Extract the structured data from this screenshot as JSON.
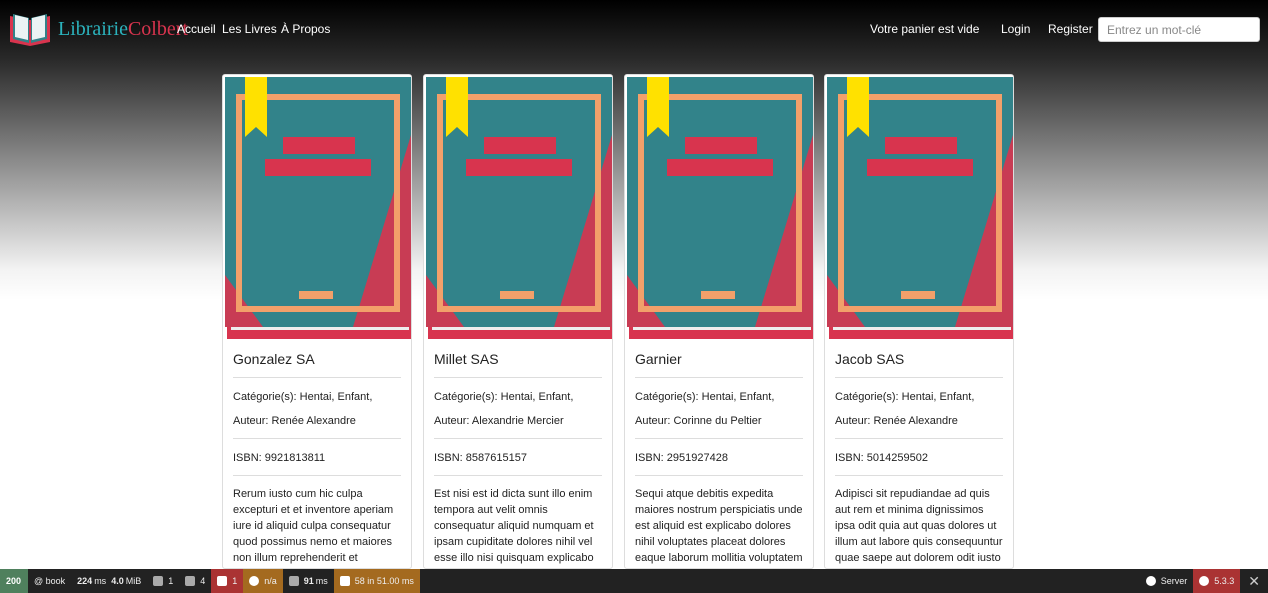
{
  "brand": {
    "part1": "Librairie",
    "part2": "Colbert"
  },
  "nav": {
    "home": "Accueil",
    "books": "Les Livres",
    "about": "À Propos",
    "cart": "Votre panier est vide",
    "login": "Login",
    "register": "Register",
    "search_placeholder": "Entrez un mot-clé"
  },
  "books": [
    {
      "title": "Gonzalez SA",
      "categories": "Catégorie(s): Hentai, Enfant,",
      "author": "Auteur: Renée Alexandre",
      "isbn": "ISBN: 9921813811",
      "description": "Rerum iusto cum hic culpa excepturi et et inventore aperiam iure id aliquid culpa consequatur quod possimus nemo et maiores non illum reprehenderit et"
    },
    {
      "title": "Millet SAS",
      "categories": "Catégorie(s): Hentai, Enfant,",
      "author": "Auteur: Alexandrie Mercier",
      "isbn": "ISBN: 8587615157",
      "description": "Est nisi est id dicta sunt illo enim tempora aut velit omnis consequatur aliquid numquam et ipsam cupiditate dolores nihil vel esse illo nisi quisquam explicabo"
    },
    {
      "title": "Garnier",
      "categories": "Catégorie(s): Hentai, Enfant,",
      "author": "Auteur: Corinne du Peltier",
      "isbn": "ISBN: 2951927428",
      "description": "Sequi atque debitis expedita maiores nostrum perspiciatis unde est aliquid est explicabo dolores nihil voluptates placeat dolores eaque laborum mollitia voluptatem"
    },
    {
      "title": "Jacob SAS",
      "categories": "Catégorie(s): Hentai, Enfant,",
      "author": "Auteur: Renée Alexandre",
      "isbn": "ISBN: 5014259502",
      "description": "Adipisci sit repudiandae ad quis aut rem et minima dignissimos ipsa odit quia aut quas dolores ut illum aut labore quis consequuntur quae saepe aut dolorem odit iusto"
    }
  ],
  "toolbar": {
    "status": "200",
    "route": "@ book",
    "time_value": "224",
    "time_unit": "ms",
    "memory": "4.0",
    "memory_unit": "MiB",
    "forms": "1",
    "logs": "4",
    "errors": "1",
    "user": "n/a",
    "twig_time": "91",
    "twig_unit": "ms",
    "db": "58 in 51.00 ms",
    "server": "Server",
    "version": "5.3.3"
  },
  "colors": {
    "cover_teal": "#32838a",
    "cover_red": "#d8344e",
    "cover_orange": "#f2a06a",
    "bookmark_yellow": "#ffe100"
  }
}
